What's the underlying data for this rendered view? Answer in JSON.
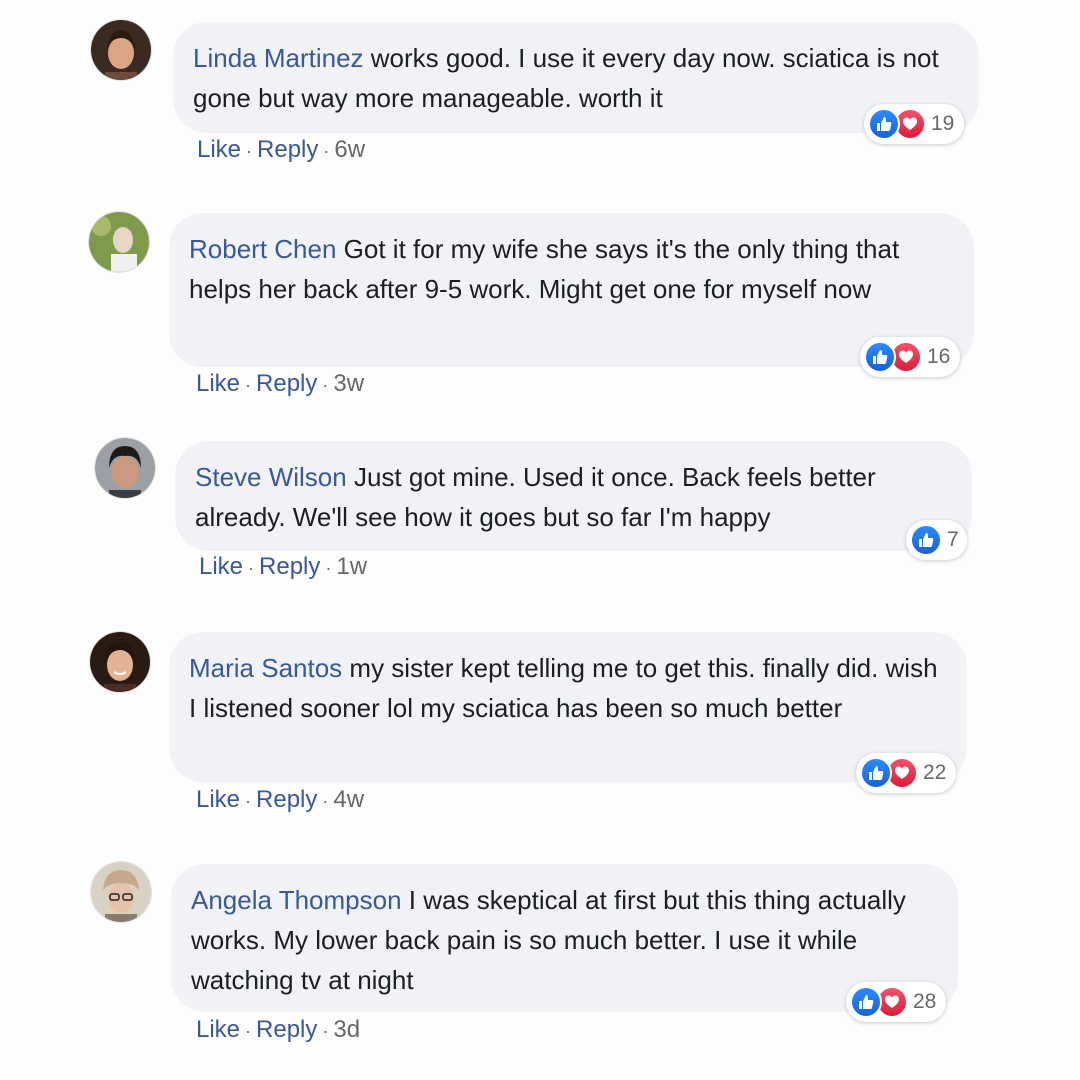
{
  "actions": {
    "like": "Like",
    "reply": "Reply",
    "separator": "·"
  },
  "colors": {
    "author": "#385898",
    "bubble": "#f0f2f5",
    "like": "#1877f2",
    "love": "#e0245e"
  },
  "comments": [
    {
      "author": "Linda Martinez",
      "text": "works good. I use it every day now. sciatica is not gone but way more manageable. worth it",
      "time": "6w",
      "reactions": [
        "like",
        "love"
      ],
      "reaction_count": "19"
    },
    {
      "author": "Robert Chen",
      "text": "Got it for my wife she says it's the only thing that helps her back after 9-5 work. Might get one for myself now",
      "time": "3w",
      "reactions": [
        "like",
        "love"
      ],
      "reaction_count": "16"
    },
    {
      "author": "Steve Wilson",
      "text": "Just got mine. Used it once. Back feels better already. We'll see how it goes but so far I'm happy",
      "time": "1w",
      "reactions": [
        "like"
      ],
      "reaction_count": "7"
    },
    {
      "author": "Maria Santos",
      "text": "my sister kept telling me to get this. finally did. wish I listened sooner lol my sciatica has been so much better",
      "time": "4w",
      "reactions": [
        "like",
        "love"
      ],
      "reaction_count": "22"
    },
    {
      "author": "Angela Thompson",
      "text": "I was skeptical at first but this thing actually works. My lower back pain is so much better. I use it while watching tv at night",
      "time": "3d",
      "reactions": [
        "like",
        "love"
      ],
      "reaction_count": "28"
    }
  ]
}
